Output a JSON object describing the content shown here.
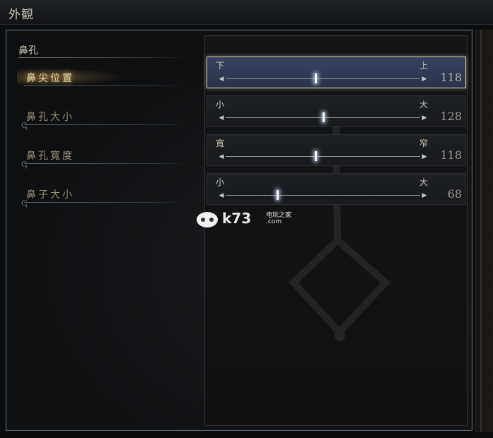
{
  "window": {
    "title": "外観"
  },
  "section": {
    "heading": "鼻孔"
  },
  "menu": {
    "items": [
      {
        "label": "鼻尖位置"
      },
      {
        "label": "鼻孔大小"
      },
      {
        "label": "鼻孔寬度"
      },
      {
        "label": "鼻子大小"
      }
    ]
  },
  "sliders": [
    {
      "left_label": "下",
      "right_label": "上",
      "value": "118",
      "level": 118,
      "max": 255
    },
    {
      "left_label": "小",
      "right_label": "大",
      "value": "128",
      "level": 128,
      "max": 255
    },
    {
      "left_label": "寬",
      "right_label": "窄",
      "value": "118",
      "level": 118,
      "max": 255
    },
    {
      "left_label": "小",
      "right_label": "大",
      "value": "68",
      "level": 68,
      "max": 255
    }
  ],
  "watermark": {
    "text": "k73",
    "sub": "电玩之家",
    "domain": ".com"
  },
  "colors": {
    "accent": "#e9d4a1",
    "active_row": "#38435f",
    "knob": "#ffffff"
  }
}
